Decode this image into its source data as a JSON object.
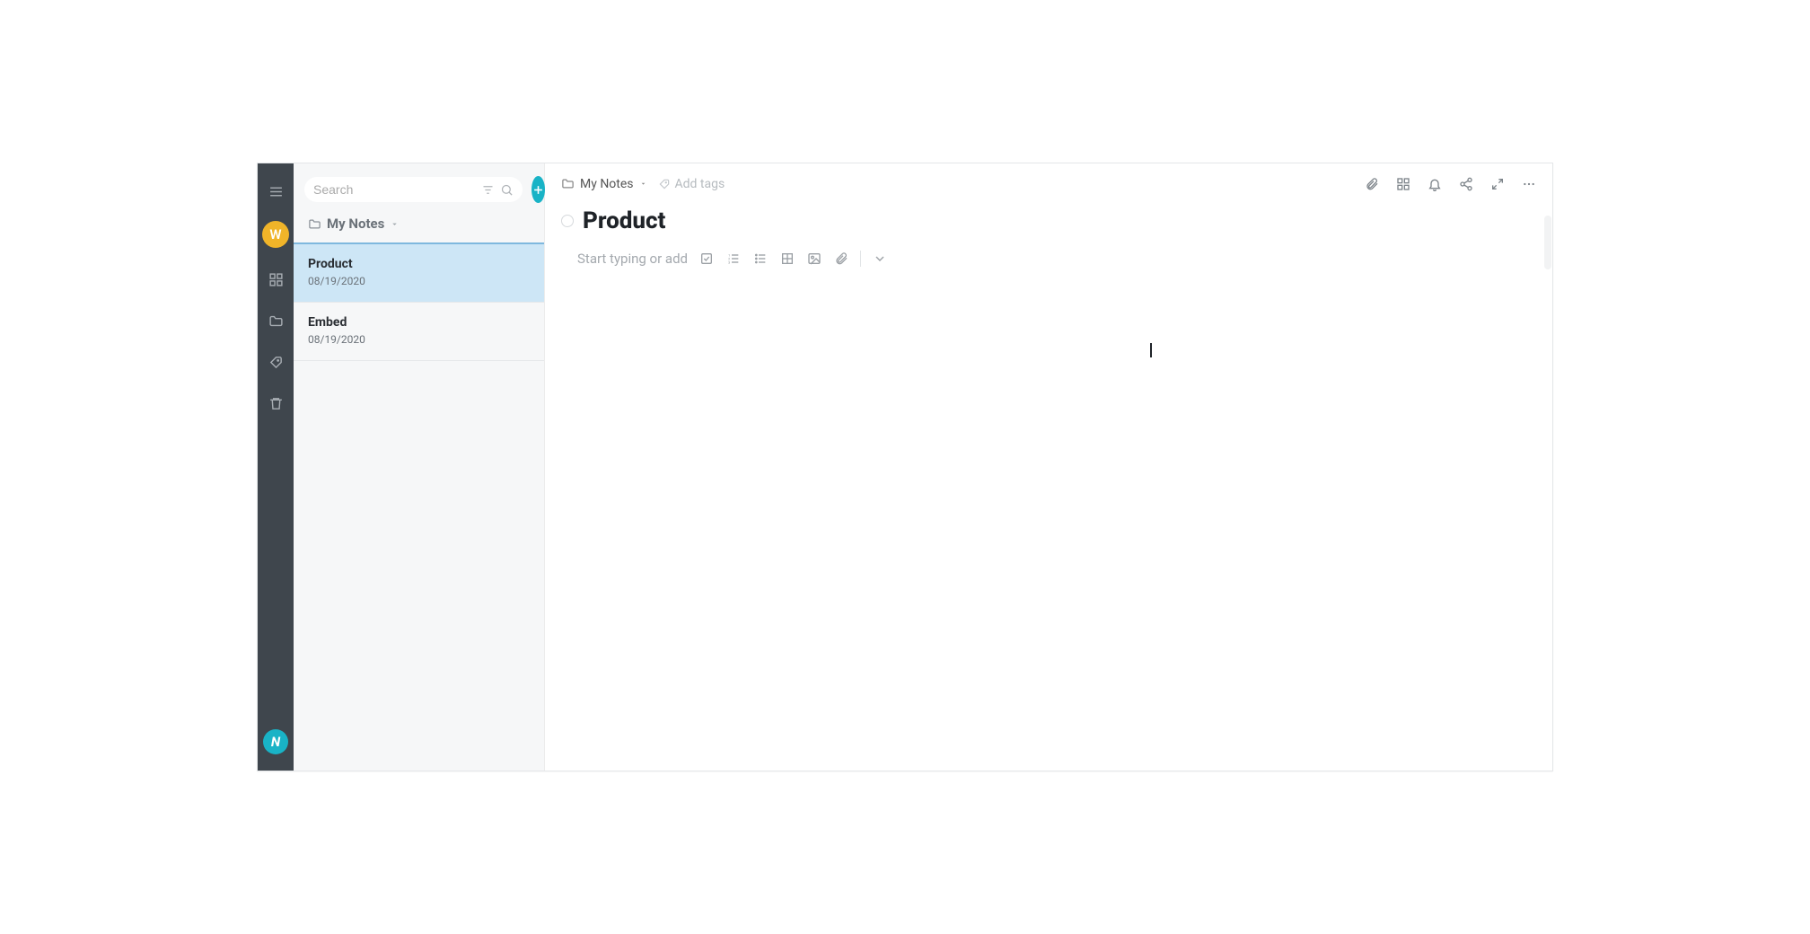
{
  "rail": {
    "avatar_letter": "W"
  },
  "search": {
    "placeholder": "Search",
    "value": ""
  },
  "list_header": {
    "label": "My Notes"
  },
  "notes": [
    {
      "title": "Product",
      "date": "08/19/2020",
      "active": true
    },
    {
      "title": "Embed",
      "date": "08/19/2020",
      "active": false
    }
  ],
  "breadcrumb": {
    "folder": "My Notes"
  },
  "tags": {
    "add_label": "Add tags"
  },
  "note": {
    "title": "Product"
  },
  "editor": {
    "placeholder": "Start typing or add"
  }
}
